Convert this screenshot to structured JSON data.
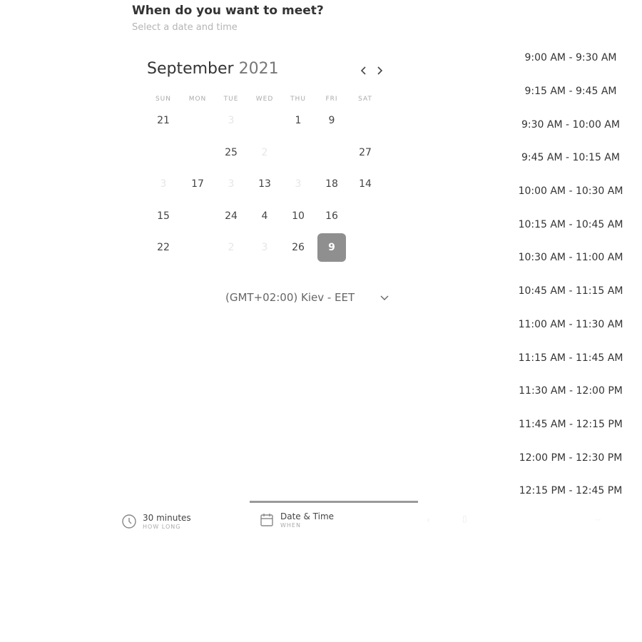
{
  "header": {
    "title": "When do you want to meet?",
    "subtitle": "Select a date and time"
  },
  "calendar": {
    "month": "September",
    "year": "2021",
    "weekdays": [
      "SUN",
      "MON",
      "TUE",
      "WED",
      "THU",
      "FRI",
      "SAT"
    ],
    "days": [
      "21",
      "1",
      "9",
      "25",
      "27",
      "17",
      "13",
      "18",
      "14",
      "15",
      "24",
      "4",
      "10",
      "16",
      "22",
      "26",
      "9"
    ],
    "faint_days": [
      "3",
      "2",
      "3",
      "3",
      "3",
      "2",
      "3"
    ],
    "selected_day": "9"
  },
  "timezone": {
    "label": "(GMT+02:00) Kiev - EET"
  },
  "slots": [
    "9:00 AM - 9:30 AM",
    "9:15 AM - 9:45 AM",
    "9:30 AM - 10:00 AM",
    "9:45 AM - 10:15 AM",
    "10:00 AM - 10:30 AM",
    "10:15 AM - 10:45 AM",
    "10:30 AM - 11:00 AM",
    "10:45 AM - 11:15 AM",
    "11:00 AM - 11:30 AM",
    "11:15 AM - 11:45 AM",
    "11:30 AM - 12:00 PM",
    "11:45 AM - 12:15 PM",
    "12:00 PM - 12:30 PM",
    "12:15 PM - 12:45 PM"
  ],
  "steps": {
    "duration": {
      "label": "30 minutes",
      "sub": "HOW LONG",
      "icon": "clock-icon"
    },
    "date": {
      "label": "Date & Time",
      "sub": "WHEN",
      "icon": "calendar-icon"
    }
  },
  "colors": {
    "selected": "#8f8f8f",
    "active_tab": "#9a9a9a"
  }
}
